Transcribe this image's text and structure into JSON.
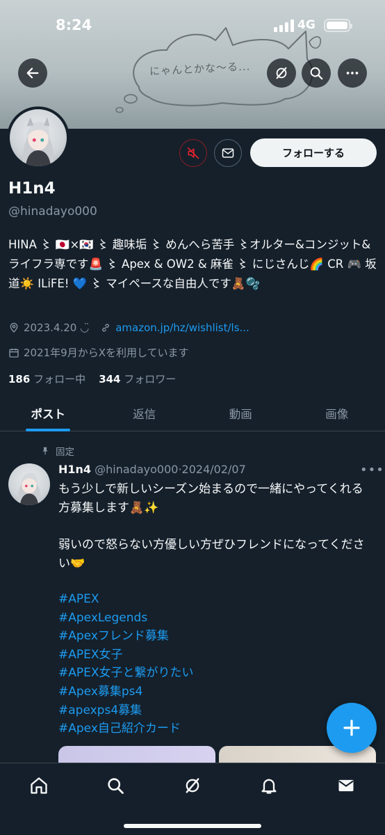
{
  "status_bar": {
    "time": "8:24",
    "network": "4G"
  },
  "banner": {
    "bubble_text": "にゃんとかな〜る..."
  },
  "header_buttons": {
    "back_icon": "arrow-left-icon",
    "grok_icon": "grok-icon",
    "search_icon": "search-icon",
    "more_icon": "more-icon"
  },
  "profile": {
    "follow_label": "フォローする",
    "display_name": "H1n4",
    "handle": "@hinadayo000",
    "bio": "HINA 〻 🇯🇵×🇰🇷 〻 趣味垢 〻 めんへら苦手 〻オルター&コンジット&ライフラ専です🚨 〻 Apex & OW2 & 麻雀 〻 にじさんじ🌈 CR 🎮 坂道☀️ ILiFE! 💙 〻 マイペースな自由人です🧸🫧",
    "birthday": "2023.4.20 ◡̈",
    "website": "amazon.jp/hz/wishlist/ls...",
    "joined": "2021年9月からXを利用しています",
    "following_count": "186",
    "following_label": "フォロー中",
    "followers_count": "344",
    "followers_label": "フォロワー"
  },
  "tabs": [
    {
      "label": "ポスト",
      "active": true
    },
    {
      "label": "返信",
      "active": false
    },
    {
      "label": "動画",
      "active": false
    },
    {
      "label": "画像",
      "active": false
    }
  ],
  "post": {
    "pinned_label": "固定",
    "name": "H1n4",
    "handle": "@hinadayo000",
    "date": "2024/02/07",
    "text_line1": "もう少しで新しいシーズン始まるので一緒にやってくれる方募集します🧸✨",
    "text_line2": "弱いので怒らない方優しい方ぜひフレンドになってください🤝",
    "hashtags": [
      "#APEX",
      "#ApexLegends",
      "#Apexフレンド募集",
      "#APEX女子",
      "#APEX女子と繋がりたい",
      "#Apex募集ps4",
      "#apexps4募集",
      "#Apex自己紹介カード"
    ]
  },
  "colors": {
    "accent": "#1d9bf0",
    "background": "#15202b",
    "muted": "#8b98a5",
    "mute_red": "#f4212e"
  }
}
